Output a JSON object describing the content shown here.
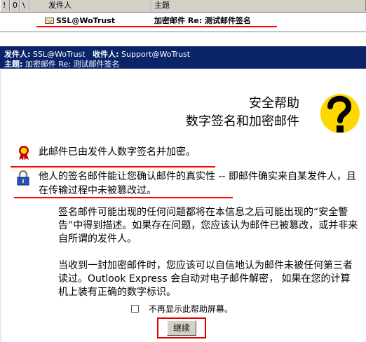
{
  "list": {
    "columns": [
      {
        "key": "priority",
        "label": "!"
      },
      {
        "key": "attach",
        "label": "0"
      },
      {
        "key": "flag",
        "label": "\\"
      },
      {
        "key": "from",
        "label": "发件人"
      },
      {
        "key": "subject",
        "label": "主题"
      }
    ],
    "rows": [
      {
        "from": "SSL@WoTrust",
        "subject": "加密邮件 Re: 测试邮件签名"
      }
    ]
  },
  "preview": {
    "from_label": "发件人:",
    "from_value": "SSL@WoTrust",
    "to_label": "收件人:",
    "to_value": "Support@WoTrust",
    "subject_label": "主题:",
    "subject_value": "加密邮件 Re: 测试邮件签名"
  },
  "help": {
    "title_line1": "安全帮助",
    "title_line2": "数字签名和加密邮件",
    "msg_signed_encrypted": "此邮件已由发件人数字签名并加密。",
    "msg_authentic": "他人的签名邮件能让您确认邮件的真实性 -- 即邮件确实来自某发件人，且在传输过程中未被篡改过。",
    "para_warning": "签名邮件可能出现的任何问题都将在本信息之后可能出现的“安全警告”中得到描述。如果存在问题，您应该认为邮件已被篡改，或并非来自所谓的发件人。",
    "para_encrypted": "当收到一封加密邮件时，您应该可以自信地认为邮件未被任何第三者读过。Outlook Express 会自动对电子邮件解密， 如果在您的计算机上装有正确的数字标识。",
    "checkbox_label": "不再显示此帮助屏幕。",
    "continue_label": "继续"
  },
  "colors": {
    "header_bg": "#0a246a",
    "highlight": "#ff0000",
    "help_icon": "#ffd700"
  },
  "icons": [
    "mail-envelope-icon",
    "ribbon-seal-icon",
    "padlock-icon",
    "question-mark-icon"
  ]
}
